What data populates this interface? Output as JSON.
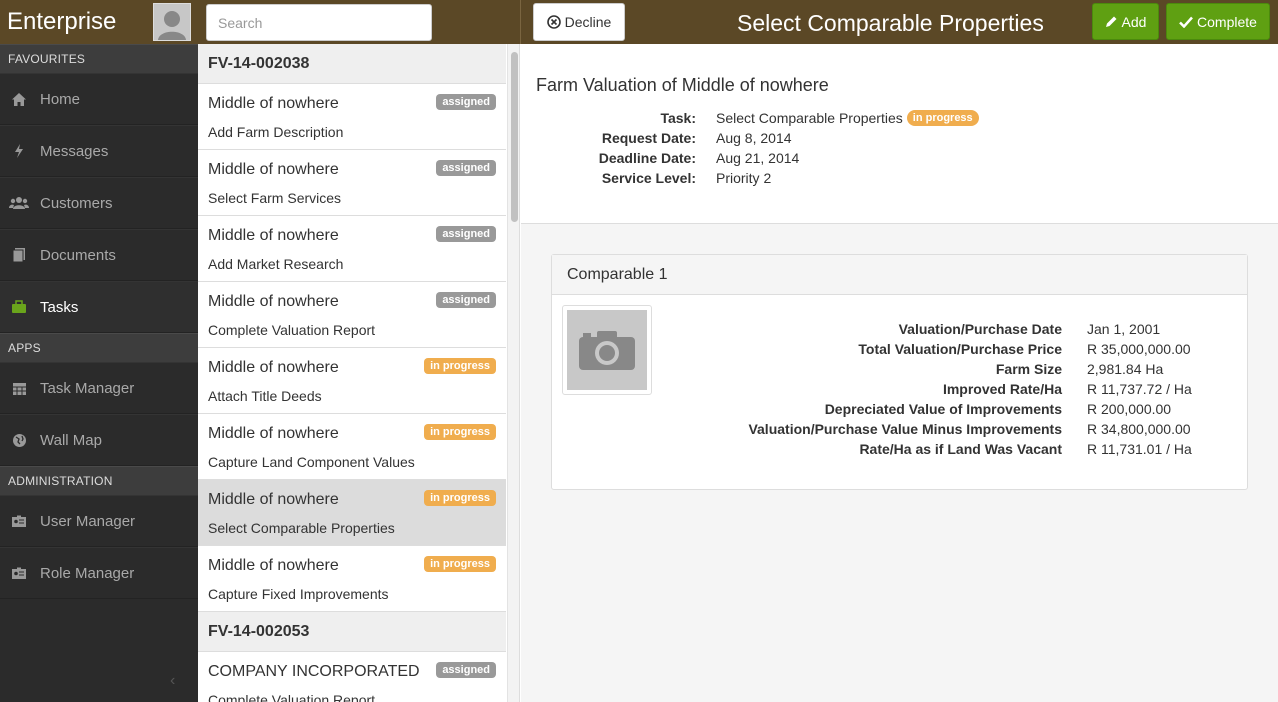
{
  "sidebar": {
    "brand": "Enterprise",
    "sections": [
      {
        "title": "FAVOURITES",
        "items": [
          {
            "label": "Home",
            "icon": "home-icon"
          },
          {
            "label": "Messages",
            "icon": "bolt-icon"
          },
          {
            "label": "Customers",
            "icon": "users-icon"
          },
          {
            "label": "Documents",
            "icon": "document-icon"
          },
          {
            "label": "Tasks",
            "icon": "briefcase-icon",
            "active": true
          }
        ]
      },
      {
        "title": "APPS",
        "items": [
          {
            "label": "Task Manager",
            "icon": "calendar-icon"
          },
          {
            "label": "Wall Map",
            "icon": "globe-icon"
          }
        ]
      },
      {
        "title": "ADMINISTRATION",
        "items": [
          {
            "label": "User Manager",
            "icon": "id-card-icon"
          },
          {
            "label": "Role Manager",
            "icon": "id-card-icon"
          }
        ]
      }
    ]
  },
  "topbar": {
    "search_placeholder": "Search",
    "decline_label": "Decline",
    "title": "Select Comparable Properties",
    "add_label": "Add",
    "complete_label": "Complete"
  },
  "tasklist": {
    "groups": [
      {
        "id": "FV-14-002038",
        "tasks": [
          {
            "name": "Middle of nowhere",
            "sub": "Add Farm Description",
            "status": "assigned"
          },
          {
            "name": "Middle of nowhere",
            "sub": "Select Farm Services",
            "status": "assigned"
          },
          {
            "name": "Middle of nowhere",
            "sub": "Add Market Research",
            "status": "assigned"
          },
          {
            "name": "Middle of nowhere",
            "sub": "Complete Valuation Report",
            "status": "assigned"
          },
          {
            "name": "Middle of nowhere",
            "sub": "Attach Title Deeds",
            "status": "in progress"
          },
          {
            "name": "Middle of nowhere",
            "sub": "Capture Land Component Values",
            "status": "in progress"
          },
          {
            "name": "Middle of nowhere",
            "sub": "Select Comparable Properties",
            "status": "in progress",
            "selected": true
          },
          {
            "name": "Middle of nowhere",
            "sub": "Capture Fixed Improvements",
            "status": "in progress"
          }
        ]
      },
      {
        "id": "FV-14-002053",
        "tasks": [
          {
            "name": "COMPANY INCORPORATED",
            "sub": "Complete Valuation Report",
            "status": "assigned"
          }
        ]
      }
    ]
  },
  "detail": {
    "title": "Farm Valuation of Middle of nowhere",
    "info": [
      {
        "label": "Task:",
        "value": "Select Comparable Properties",
        "badge": "in progress"
      },
      {
        "label": "Request Date:",
        "value": "Aug 8, 2014"
      },
      {
        "label": "Deadline Date:",
        "value": "Aug 21, 2014"
      },
      {
        "label": "Service Level:",
        "value": "Priority 2"
      }
    ],
    "comparable": {
      "title": "Comparable 1",
      "rows": [
        {
          "label": "Valuation/Purchase Date",
          "value": "Jan 1, 2001"
        },
        {
          "label": "Total Valuation/Purchase Price",
          "value": "R 35,000,000.00"
        },
        {
          "label": "Farm Size",
          "value": "2,981.84 Ha"
        },
        {
          "label": "Improved Rate/Ha",
          "value": "R 11,737.72 / Ha"
        },
        {
          "label": "Depreciated Value of Improvements",
          "value": "R 200,000.00"
        },
        {
          "label": "Valuation/Purchase Value Minus Improvements",
          "value": "R 34,800,000.00"
        },
        {
          "label": "Rate/Ha as if Land Was Vacant",
          "value": "R 11,731.01 / Ha"
        }
      ]
    }
  }
}
